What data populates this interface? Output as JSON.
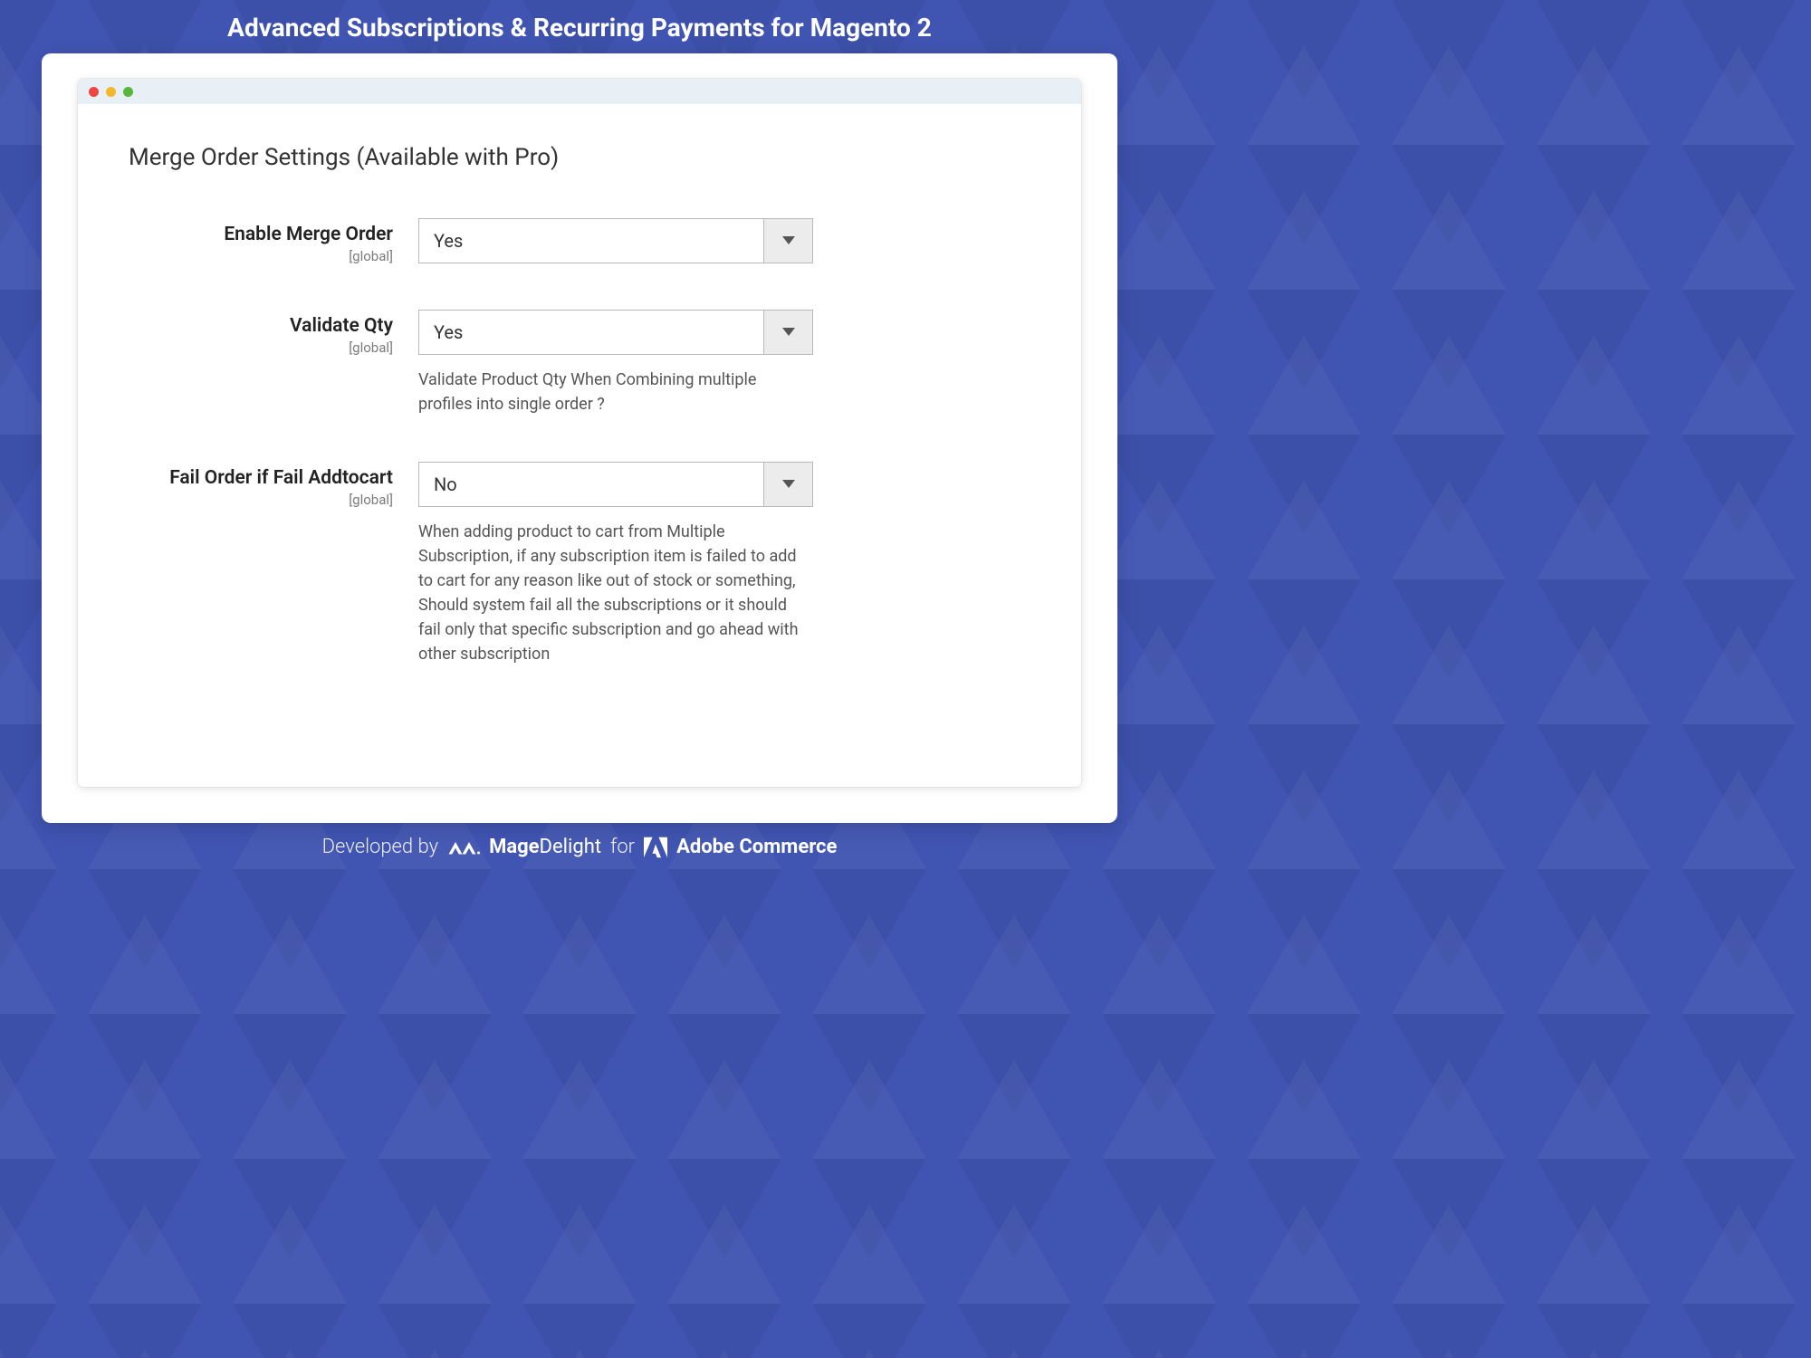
{
  "header": {
    "title": "Advanced Subscriptions & Recurring Payments for Magento 2"
  },
  "section": {
    "heading": "Merge Order Settings (Available with Pro)"
  },
  "fields": {
    "enable_merge": {
      "label": "Enable Merge Order",
      "scope": "[global]",
      "value": "Yes"
    },
    "validate_qty": {
      "label": "Validate Qty",
      "scope": "[global]",
      "value": "Yes",
      "helper": "Validate Product Qty When Combining multiple profiles into single order ?"
    },
    "fail_order": {
      "label": "Fail Order if Fail Addtocart",
      "scope": "[global]",
      "value": "No",
      "helper": "When adding product to cart from Multiple Subscription, if any subscription item is failed to add to cart for any reason like out of stock or something, Should system fail all the subscriptions or it should fail only that specific subscription and go ahead with other subscription"
    }
  },
  "footer": {
    "developed_by": "Developed by",
    "brand1a": "Mage",
    "brand1b": "Delight",
    "for": "for",
    "brand2": "Adobe Commerce"
  }
}
